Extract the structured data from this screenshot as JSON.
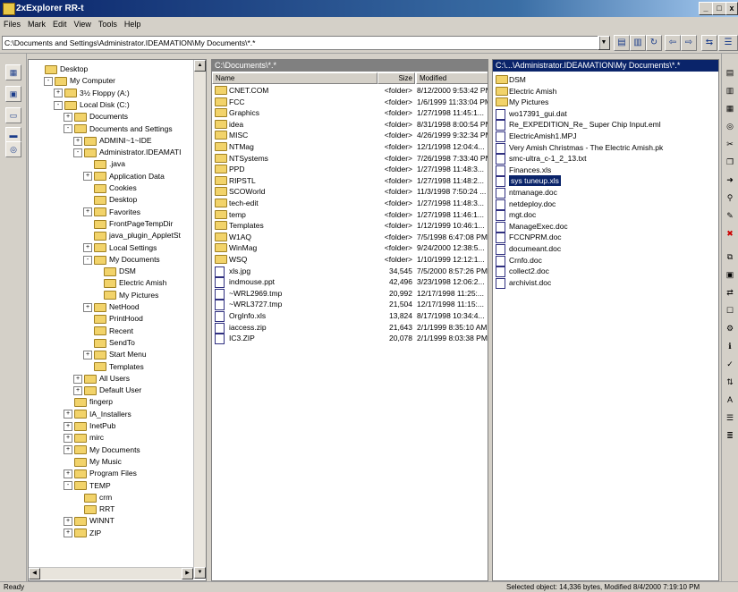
{
  "window": {
    "title": "2xExplorer RR-t",
    "min_label": "_",
    "max_label": "□",
    "close_label": "x"
  },
  "menu": [
    "Files",
    "Mark",
    "Edit",
    "View",
    "Tools",
    "Help"
  ],
  "address": {
    "value": "C:\\Documents and Settings\\Administrator.IDEAMATION\\My Documents\\*.*"
  },
  "tree": [
    {
      "label": "Desktop",
      "lvl": 0,
      "exp": "none"
    },
    {
      "label": "My Computer",
      "lvl": 1,
      "exp": "-"
    },
    {
      "label": "3½ Floppy (A:)",
      "lvl": 2,
      "exp": "+"
    },
    {
      "label": "Local Disk (C:)",
      "lvl": 2,
      "exp": "-"
    },
    {
      "label": "Documents",
      "lvl": 3,
      "exp": "+"
    },
    {
      "label": "Documents and Settings",
      "lvl": 3,
      "exp": "-"
    },
    {
      "label": "ADMINI~1~IDE",
      "lvl": 4,
      "exp": "+"
    },
    {
      "label": "Administrator.IDEAMATI",
      "lvl": 4,
      "exp": "-"
    },
    {
      "label": ".java",
      "lvl": 5,
      "exp": "none"
    },
    {
      "label": "Application Data",
      "lvl": 5,
      "exp": "+"
    },
    {
      "label": "Cookies",
      "lvl": 5,
      "exp": "none"
    },
    {
      "label": "Desktop",
      "lvl": 5,
      "exp": "none"
    },
    {
      "label": "Favorites",
      "lvl": 5,
      "exp": "+"
    },
    {
      "label": "FrontPageTempDir",
      "lvl": 5,
      "exp": "none"
    },
    {
      "label": "java_plugin_AppletSt",
      "lvl": 5,
      "exp": "none"
    },
    {
      "label": "Local Settings",
      "lvl": 5,
      "exp": "+"
    },
    {
      "label": "My Documents",
      "lvl": 5,
      "exp": "-"
    },
    {
      "label": "DSM",
      "lvl": 6,
      "exp": "none"
    },
    {
      "label": "Electric Amish",
      "lvl": 6,
      "exp": "none"
    },
    {
      "label": "My Pictures",
      "lvl": 6,
      "exp": "none"
    },
    {
      "label": "NetHood",
      "lvl": 5,
      "exp": "+"
    },
    {
      "label": "PrintHood",
      "lvl": 5,
      "exp": "none"
    },
    {
      "label": "Recent",
      "lvl": 5,
      "exp": "none"
    },
    {
      "label": "SendTo",
      "lvl": 5,
      "exp": "none"
    },
    {
      "label": "Start Menu",
      "lvl": 5,
      "exp": "+"
    },
    {
      "label": "Templates",
      "lvl": 5,
      "exp": "none"
    },
    {
      "label": "All Users",
      "lvl": 4,
      "exp": "+"
    },
    {
      "label": "Default User",
      "lvl": 4,
      "exp": "+"
    },
    {
      "label": "fingerp",
      "lvl": 3,
      "exp": "none"
    },
    {
      "label": "IA_Installers",
      "lvl": 3,
      "exp": "+"
    },
    {
      "label": "InetPub",
      "lvl": 3,
      "exp": "+"
    },
    {
      "label": "mirc",
      "lvl": 3,
      "exp": "+"
    },
    {
      "label": "My Documents",
      "lvl": 3,
      "exp": "+"
    },
    {
      "label": "My Music",
      "lvl": 3,
      "exp": "none"
    },
    {
      "label": "Program Files",
      "lvl": 3,
      "exp": "+"
    },
    {
      "label": "TEMP",
      "lvl": 3,
      "exp": "-"
    },
    {
      "label": "crm",
      "lvl": 4,
      "exp": "none"
    },
    {
      "label": "RRT",
      "lvl": 4,
      "exp": "none"
    },
    {
      "label": "WINNT",
      "lvl": 3,
      "exp": "+"
    },
    {
      "label": "ZIP",
      "lvl": 3,
      "exp": "+"
    }
  ],
  "left_pane": {
    "header": "C:\\Documents\\*.*",
    "columns": {
      "name": "Name",
      "size": "Size",
      "modified": "Modified"
    },
    "rows": [
      {
        "name": "CNET.COM",
        "size": "<folder>",
        "modified": "8/12/2000 9:53:42 PM",
        "kind": "folder"
      },
      {
        "name": "FCC",
        "size": "<folder>",
        "modified": "1/6/1999 11:33:04 PM",
        "kind": "folder"
      },
      {
        "name": "Graphics",
        "size": "<folder>",
        "modified": "1/27/1998 11:45:1...",
        "kind": "folder"
      },
      {
        "name": "idea",
        "size": "<folder>",
        "modified": "8/31/1998 8:00:54 PM",
        "kind": "folder"
      },
      {
        "name": "MISC",
        "size": "<folder>",
        "modified": "4/26/1999 9:32:34 PM",
        "kind": "folder"
      },
      {
        "name": "NTMag",
        "size": "<folder>",
        "modified": "12/1/1998 12:04:4...",
        "kind": "folder"
      },
      {
        "name": "NTSystems",
        "size": "<folder>",
        "modified": "7/26/1998 7:33:40 PM",
        "kind": "folder"
      },
      {
        "name": "PPD",
        "size": "<folder>",
        "modified": "1/27/1998 11:48:3...",
        "kind": "folder"
      },
      {
        "name": "RIPSTL",
        "size": "<folder>",
        "modified": "1/27/1998 11:48:2...",
        "kind": "folder"
      },
      {
        "name": "SCOWorld",
        "size": "<folder>",
        "modified": "11/3/1998 7:50:24 ...",
        "kind": "folder"
      },
      {
        "name": "tech-edit",
        "size": "<folder>",
        "modified": "1/27/1998 11:48:3...",
        "kind": "folder"
      },
      {
        "name": "temp",
        "size": "<folder>",
        "modified": "1/27/1998 11:46:1...",
        "kind": "folder"
      },
      {
        "name": "Templates",
        "size": "<folder>",
        "modified": "1/12/1999 10:46:1...",
        "kind": "folder"
      },
      {
        "name": "W1AQ",
        "size": "<folder>",
        "modified": "7/5/1998 6:47:08 PM",
        "kind": "folder"
      },
      {
        "name": "WinMag",
        "size": "<folder>",
        "modified": "9/24/2000 12:38:5...",
        "kind": "folder"
      },
      {
        "name": "WSQ",
        "size": "<folder>",
        "modified": "1/10/1999 12:12:1...",
        "kind": "folder"
      },
      {
        "name": "xls.jpg",
        "size": "34,545",
        "modified": "7/5/2000 8:57:26 PM",
        "kind": "file"
      },
      {
        "name": "indmouse.ppt",
        "size": "42,496",
        "modified": "3/23/1998 12:06:2...",
        "kind": "file"
      },
      {
        "name": "~WRL2969.tmp",
        "size": "20,992",
        "modified": "12/17/1998 11:25:...",
        "kind": "file"
      },
      {
        "name": "~WRL3727.tmp",
        "size": "21,504",
        "modified": "12/17/1998 11:15:...",
        "kind": "file"
      },
      {
        "name": "OrgInfo.xls",
        "size": "13,824",
        "modified": "8/17/1998 10:34:4...",
        "kind": "file"
      },
      {
        "name": "iaccess.zip",
        "size": "21,643",
        "modified": "2/1/1999 8:35:10 AM",
        "kind": "file"
      },
      {
        "name": "IC3.ZIP",
        "size": "20,078",
        "modified": "2/1/1999 8:03:38 PM",
        "kind": "file"
      }
    ]
  },
  "right_pane": {
    "header": "C:\\...\\Administrator.IDEAMATION\\My Documents\\*.*",
    "rows": [
      {
        "name": "DSM",
        "kind": "folder",
        "selected": false
      },
      {
        "name": "Electric Amish",
        "kind": "folder",
        "selected": false
      },
      {
        "name": "My Pictures",
        "kind": "folder",
        "selected": false
      },
      {
        "name": "wo17391_gui.dat",
        "kind": "file",
        "selected": false
      },
      {
        "name": "Re_EXPEDITION_Re_ Super Chip Input.eml",
        "kind": "file",
        "selected": false
      },
      {
        "name": "ElectricAmish1.MPJ",
        "kind": "file",
        "selected": false
      },
      {
        "name": "Very Amish Christmas - The Electric Amish.pk",
        "kind": "file",
        "selected": false
      },
      {
        "name": "smc-ultra_c-1_2_13.txt",
        "kind": "file",
        "selected": false
      },
      {
        "name": "Finances.xls",
        "kind": "file",
        "selected": false
      },
      {
        "name": "sys tuneup.xls",
        "kind": "file",
        "selected": true
      },
      {
        "name": "ntmanage.doc",
        "kind": "file",
        "selected": false
      },
      {
        "name": "netdeploy.doc",
        "kind": "file",
        "selected": false
      },
      {
        "name": "mgt.doc",
        "kind": "file",
        "selected": false
      },
      {
        "name": "ManageExec.doc",
        "kind": "file",
        "selected": false
      },
      {
        "name": "FCCNPRM.doc",
        "kind": "file",
        "selected": false
      },
      {
        "name": "documeant.doc",
        "kind": "file",
        "selected": false
      },
      {
        "name": "Crnfo.doc",
        "kind": "file",
        "selected": false
      },
      {
        "name": "collect2.doc",
        "kind": "file",
        "selected": false
      },
      {
        "name": "archivist.doc",
        "kind": "file",
        "selected": false
      }
    ]
  },
  "status": {
    "left": "Ready",
    "right": "Selected object: 14,336 bytes, Modified 8/4/2000 7:19:10 PM"
  },
  "colors": {
    "pane_header_active": "#0a246a",
    "pane_header_inactive": "#808080",
    "selection": "#0a246a",
    "folder": "#f2d36a"
  }
}
